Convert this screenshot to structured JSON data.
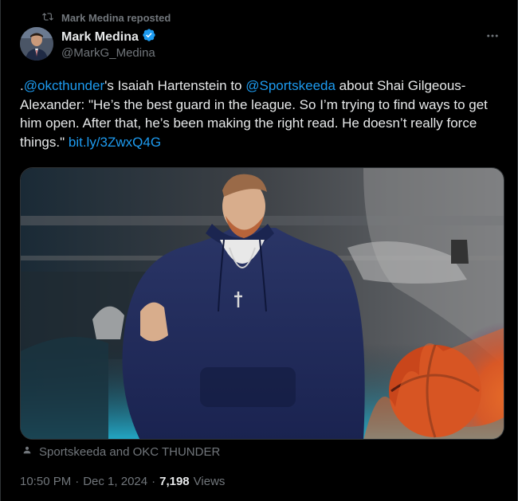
{
  "repost": {
    "label": "Mark Medina reposted",
    "icon": "repost-icon"
  },
  "author": {
    "display_name": "Mark Medina",
    "handle": "@MarkG_Medina",
    "verified_icon": "verified-badge-icon",
    "verified_color": "#1d9bf0"
  },
  "more_icon": "more-options-icon",
  "tweet": {
    "prefix": ".",
    "mention1": "@okcthunder",
    "text1": "'s Isaiah Hartenstein to ",
    "mention2": "@Sportskeeda",
    "text2": " about Shai Gilgeous-Alexander: \"He’s the best guard in the league. So I’m trying to find ways to get him open. After that, he’s been making the right read. He doesn’t really force things.\" ",
    "link": "bit.ly/3ZwxQ4G",
    "link_color": "#1d9bf0"
  },
  "media": {
    "icon": "photo-media"
  },
  "tagged": {
    "icon": "person-icon",
    "text": "Sportskeeda and OKC THUNDER"
  },
  "meta": {
    "time": "10:50 PM",
    "separator": "·",
    "date": "Dec 1, 2024",
    "views_count": "7,198",
    "views_label": "Views"
  }
}
